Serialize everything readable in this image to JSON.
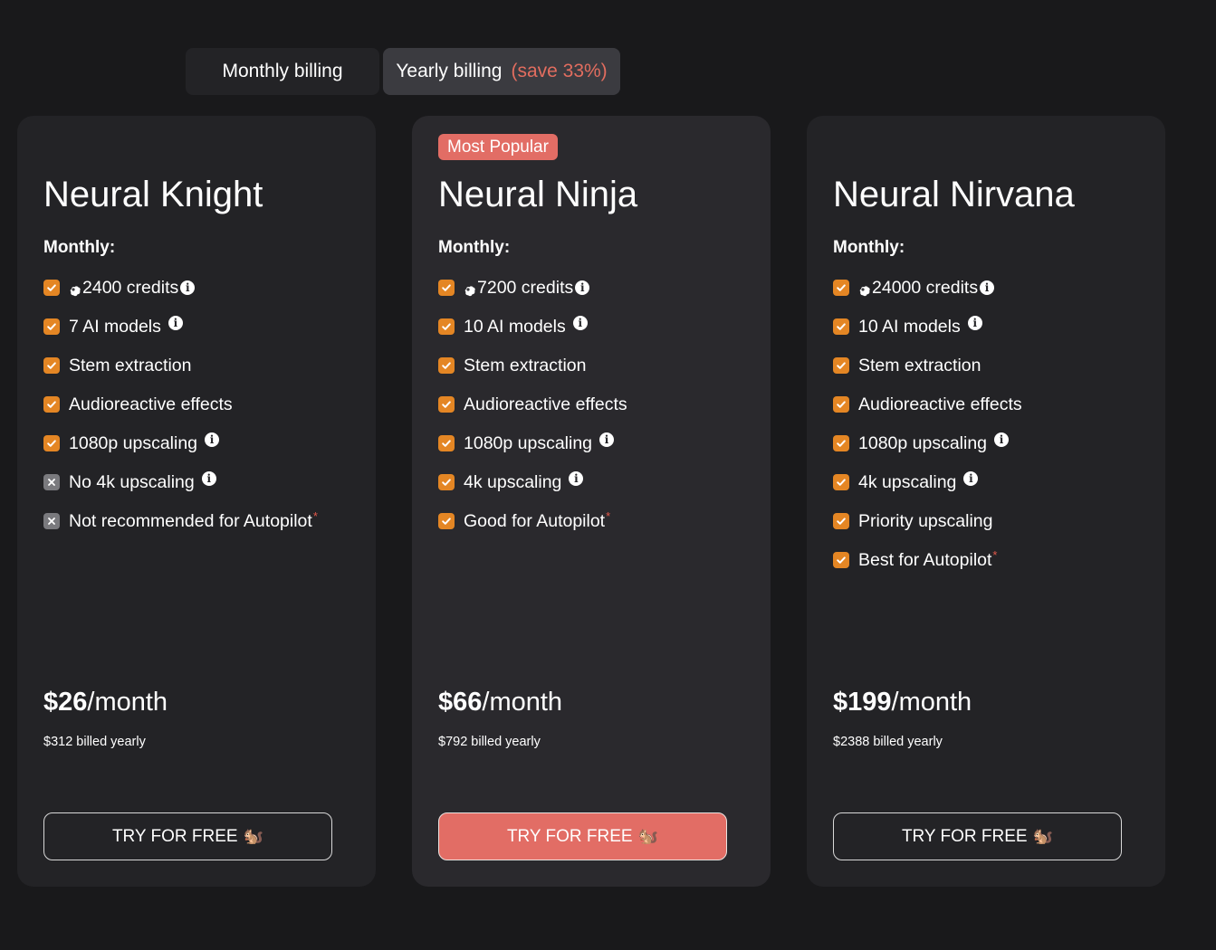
{
  "billing": {
    "monthly_label": "Monthly billing",
    "yearly_label": "Yearly billing",
    "yearly_save": "(save 33%)"
  },
  "accent_color": "#e48624",
  "brand_color": "#e26d65",
  "plans": [
    {
      "name": "Neural Knight",
      "badge": "",
      "period_label": "Monthly:",
      "features": [
        {
          "text": "2400 credits",
          "enabled": true,
          "icon": "credit-icon",
          "info": true
        },
        {
          "text": "7 AI models",
          "enabled": true,
          "info": true
        },
        {
          "text": "Stem extraction",
          "enabled": true,
          "info": false
        },
        {
          "text": "Audioreactive effects",
          "enabled": true,
          "info": false
        },
        {
          "text": "1080p upscaling",
          "enabled": true,
          "info": true
        },
        {
          "text": "No 4k upscaling",
          "enabled": false,
          "info": true
        },
        {
          "text": "Not recommended for Autopilot",
          "enabled": false,
          "info": false,
          "asterisk": "*"
        }
      ],
      "price": "$26",
      "price_unit": "/month",
      "billed": "$312 billed yearly",
      "cta": "TRY FOR FREE",
      "cta_icon": "🐿️"
    },
    {
      "name": "Neural Ninja",
      "badge": "Most Popular",
      "period_label": "Monthly:",
      "features": [
        {
          "text": "7200 credits",
          "enabled": true,
          "icon": "credit-icon",
          "info": true
        },
        {
          "text": "10 AI models",
          "enabled": true,
          "info": true
        },
        {
          "text": "Stem extraction",
          "enabled": true,
          "info": false
        },
        {
          "text": "Audioreactive effects",
          "enabled": true,
          "info": false
        },
        {
          "text": "1080p upscaling",
          "enabled": true,
          "info": true
        },
        {
          "text": "4k upscaling",
          "enabled": true,
          "info": true
        },
        {
          "text": "Good for Autopilot",
          "enabled": true,
          "info": false,
          "asterisk": "*"
        }
      ],
      "price": "$66",
      "price_unit": "/month",
      "billed": "$792 billed yearly",
      "cta": "TRY FOR FREE",
      "cta_icon": "🐿️"
    },
    {
      "name": "Neural Nirvana",
      "badge": "",
      "period_label": "Monthly:",
      "features": [
        {
          "text": "24000 credits",
          "enabled": true,
          "icon": "credit-icon",
          "info": true
        },
        {
          "text": "10 AI models",
          "enabled": true,
          "info": true
        },
        {
          "text": "Stem extraction",
          "enabled": true,
          "info": false
        },
        {
          "text": "Audioreactive effects",
          "enabled": true,
          "info": false
        },
        {
          "text": "1080p upscaling",
          "enabled": true,
          "info": true
        },
        {
          "text": "4k upscaling",
          "enabled": true,
          "info": true
        },
        {
          "text": "Priority upscaling",
          "enabled": true,
          "info": false
        },
        {
          "text": "Best for Autopilot",
          "enabled": true,
          "info": false,
          "asterisk": "*"
        }
      ],
      "price": "$199",
      "price_unit": "/month",
      "billed": "$2388 billed yearly",
      "cta": "TRY FOR FREE",
      "cta_icon": "🐿️"
    }
  ]
}
